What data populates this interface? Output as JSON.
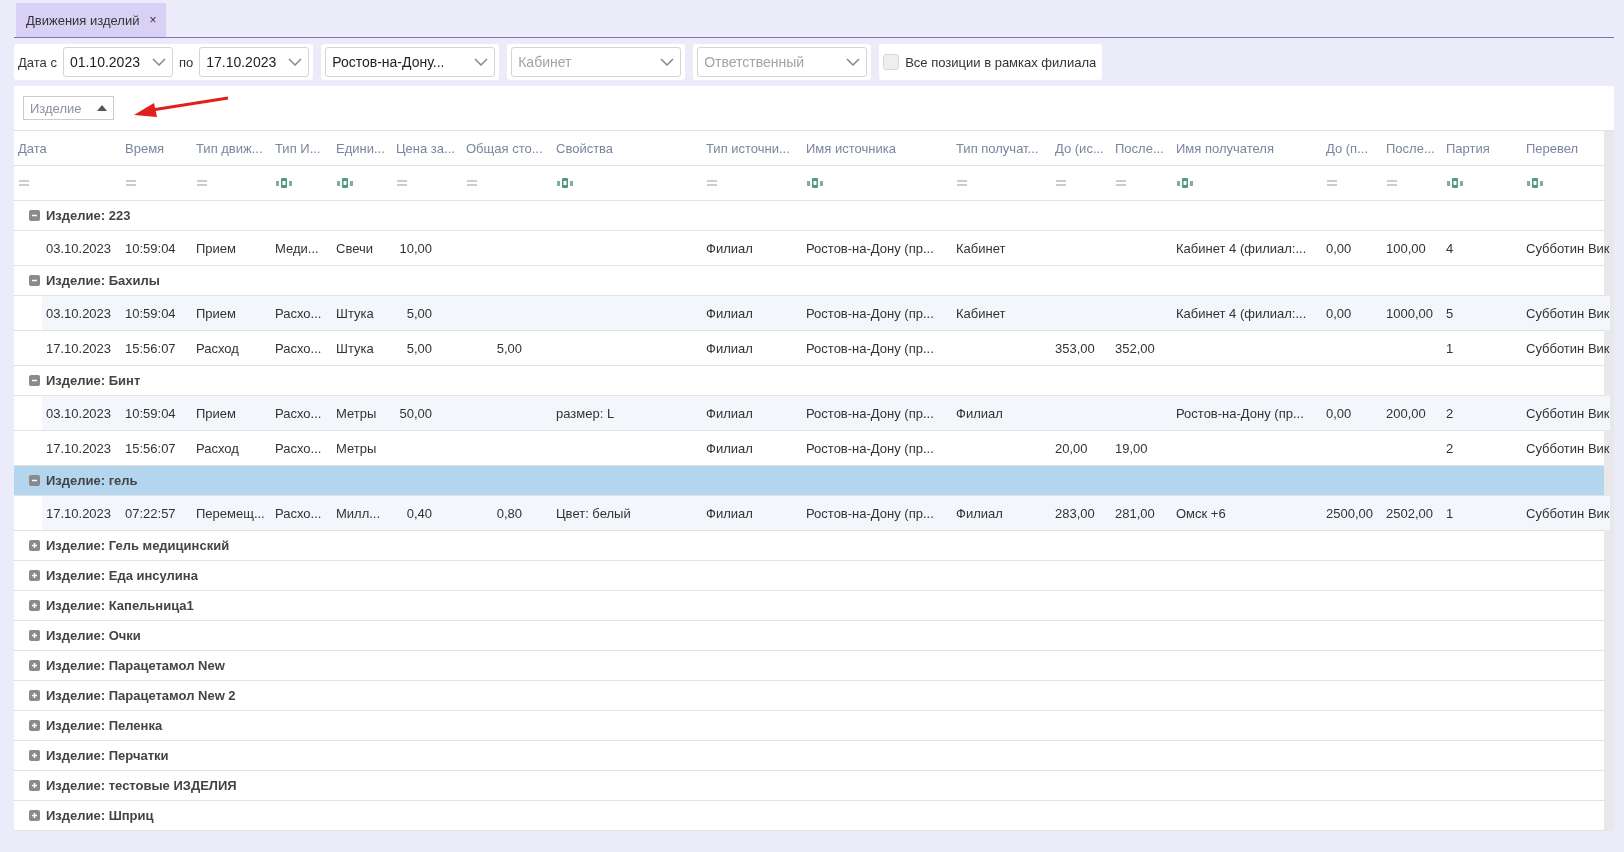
{
  "tabs": [
    {
      "label": "Движения изделий",
      "selected": true,
      "close": "×"
    }
  ],
  "toolbar": {
    "date_from_label": "Дата с",
    "date_from": "01.10.2023",
    "date_to_label": "по",
    "date_to": "17.10.2023",
    "branch": "Ростов-на-Дону...",
    "office_placeholder": "Кабинет",
    "responsible_placeholder": "Ответственный",
    "all_positions": {
      "label": "Все позиции в рамках филиала",
      "checked": false
    }
  },
  "group_panel": {
    "chips": [
      {
        "label": "Изделие",
        "sorted_ascending": true
      }
    ]
  },
  "table": {
    "columns": [
      {
        "label": "Дата",
        "kind": "equals"
      },
      {
        "label": "Время",
        "kind": "equals"
      },
      {
        "label": "Тип движ...",
        "kind": "equals"
      },
      {
        "label": "Тип И...",
        "kind": "text"
      },
      {
        "label": "Едини...",
        "kind": "text"
      },
      {
        "label": "Цена за...",
        "kind": "equals"
      },
      {
        "label": "Общая сто...",
        "kind": "equals"
      },
      {
        "label": "Свойства",
        "kind": "text"
      },
      {
        "label": "Тип источни...",
        "kind": "equals"
      },
      {
        "label": "Имя источника",
        "kind": "text"
      },
      {
        "label": "Тип получат...",
        "kind": "equals"
      },
      {
        "label": "До (ис...",
        "kind": "equals"
      },
      {
        "label": "После...",
        "kind": "equals"
      },
      {
        "label": "Имя получателя",
        "kind": "text"
      },
      {
        "label": "До (п...",
        "kind": "equals"
      },
      {
        "label": "После...",
        "kind": "equals"
      },
      {
        "label": "Партия",
        "kind": "text"
      },
      {
        "label": "Перевел",
        "kind": "text"
      }
    ],
    "groups": [
      {
        "label": "Изделие: 223",
        "expanded": true,
        "selected": false,
        "rows": [
          {
            "shaded": false,
            "cells": [
              "03.10.2023",
              "10:59:04",
              "Прием",
              "Меди...",
              "Свечи",
              "10,00",
              null,
              null,
              "Филиал",
              "Ростов-на-Дону (пр...",
              "Кабинет",
              null,
              null,
              "Кабинет 4 (филиал:...",
              "0,00",
              "100,00",
              "4",
              "Субботин Вик"
            ]
          }
        ]
      },
      {
        "label": "Изделие: Бахилы",
        "expanded": true,
        "selected": false,
        "rows": [
          {
            "shaded": true,
            "cells": [
              "03.10.2023",
              "10:59:04",
              "Прием",
              "Расхо...",
              "Штука",
              "5,00",
              null,
              null,
              "Филиал",
              "Ростов-на-Дону (пр...",
              "Кабинет",
              null,
              null,
              "Кабинет 4 (филиал:...",
              "0,00",
              "1000,00",
              "5",
              "Субботин Вик"
            ]
          },
          {
            "shaded": false,
            "cells": [
              "17.10.2023",
              "15:56:07",
              "Расход",
              "Расхо...",
              "Штука",
              "5,00",
              "5,00",
              null,
              "Филиал",
              "Ростов-на-Дону (пр...",
              null,
              "353,00",
              "352,00",
              null,
              null,
              null,
              "1",
              "Субботин Вик"
            ]
          }
        ]
      },
      {
        "label": "Изделие: Бинт",
        "expanded": true,
        "selected": false,
        "rows": [
          {
            "shaded": true,
            "cells": [
              "03.10.2023",
              "10:59:04",
              "Прием",
              "Расхо...",
              "Метры",
              "50,00",
              null,
              "размер: L",
              "Филиал",
              "Ростов-на-Дону (пр...",
              "Филиал",
              null,
              null,
              "Ростов-на-Дону (пр...",
              "0,00",
              "200,00",
              "2",
              "Субботин Вик"
            ]
          },
          {
            "shaded": false,
            "cells": [
              "17.10.2023",
              "15:56:07",
              "Расход",
              "Расхо...",
              "Метры",
              null,
              null,
              null,
              "Филиал",
              "Ростов-на-Дону (пр...",
              null,
              "20,00",
              "19,00",
              null,
              null,
              null,
              "2",
              "Субботин Вик"
            ]
          }
        ]
      },
      {
        "label": "Изделие: гель",
        "expanded": true,
        "selected": true,
        "rows": [
          {
            "shaded": true,
            "cells": [
              "17.10.2023",
              "07:22:57",
              "Перемещ...",
              "Расхо...",
              "Милл...",
              "0,40",
              "0,80",
              "Цвет: белый",
              "Филиал",
              "Ростов-на-Дону (пр...",
              "Филиал",
              "283,00",
              "281,00",
              "Омск +6",
              "2500,00",
              "2502,00",
              "1",
              "Субботин Вик"
            ]
          }
        ]
      },
      {
        "label": "Изделие: Гель медицинский",
        "expanded": false,
        "selected": false
      },
      {
        "label": "Изделие: Еда инсулина",
        "expanded": false,
        "selected": false
      },
      {
        "label": "Изделие: Капельница1",
        "expanded": false,
        "selected": false
      },
      {
        "label": "Изделие: Очки",
        "expanded": false,
        "selected": false
      },
      {
        "label": "Изделие: Парацетамол New",
        "expanded": false,
        "selected": false
      },
      {
        "label": "Изделие: Парацетамол New 2",
        "expanded": false,
        "selected": false
      },
      {
        "label": "Изделие: Пеленка",
        "expanded": false,
        "selected": false
      },
      {
        "label": "Изделие: Перчатки",
        "expanded": false,
        "selected": false
      },
      {
        "label": "Изделие: тестовые ИЗДЕЛИЯ",
        "expanded": false,
        "selected": false
      },
      {
        "label": "Изделие: Шприц",
        "expanded": false,
        "selected": false
      }
    ]
  }
}
